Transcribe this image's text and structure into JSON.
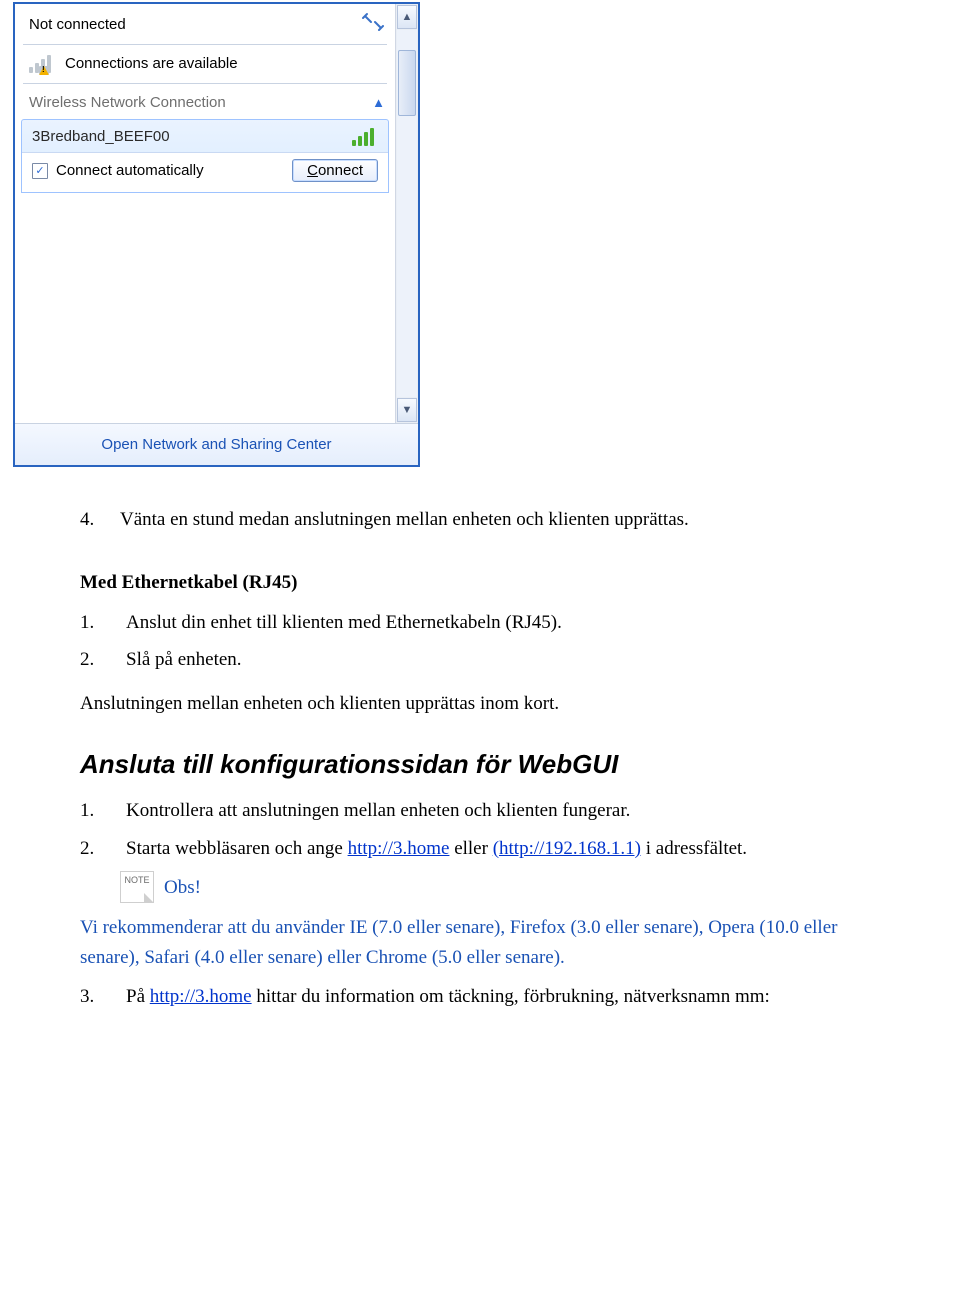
{
  "flyout": {
    "status": "Not connected",
    "available": "Connections are available",
    "section": "Wireless Network Connection",
    "network_name": "3Bredband_BEEF00",
    "auto_label": "Connect automatically",
    "connect_prefix": "C",
    "connect_rest": "onnect",
    "open_center": "Open Network and Sharing Center"
  },
  "doc": {
    "step4_num": "4.",
    "step4": "Vänta en stund medan anslutningen mellan enheten och klienten upprättas.",
    "eth_heading": "Med Ethernetkabel (RJ45)",
    "eth1_num": "1.",
    "eth1": "Anslut din enhet till klienten med Ethernetkabeln (RJ45).",
    "eth2_num": "2.",
    "eth2": "Slå på enheten.",
    "eth_note": "Anslutningen mellan enheten och klienten upprättas inom kort.",
    "webgui_heading": "Ansluta till konfigurationssidan för WebGUI",
    "wg1_num": "1.",
    "wg1": "Kontrollera att anslutningen mellan enheten och klienten fungerar.",
    "wg2_num": "2.",
    "wg2_a": "Starta webbläsaren och ange ",
    "wg2_link1": "http://3.home",
    "wg2_b": " eller ",
    "wg2_link2": "(http://192.168.1.1)",
    "wg2_c": " i adressfältet.",
    "note_badge": "NOTE",
    "note_label": "Obs!",
    "rec_text": "Vi rekommenderar att du använder IE (7.0 eller senare), Firefox (3.0 eller senare), Opera (10.0 eller senare), Safari (4.0 eller senare) eller Chrome (5.0 eller senare).",
    "wg3_num": "3.",
    "wg3_a": "På ",
    "wg3_link": "http://3.home",
    "wg3_b": " hittar du information om täckning, förbrukning, nätverksnamn mm:"
  }
}
